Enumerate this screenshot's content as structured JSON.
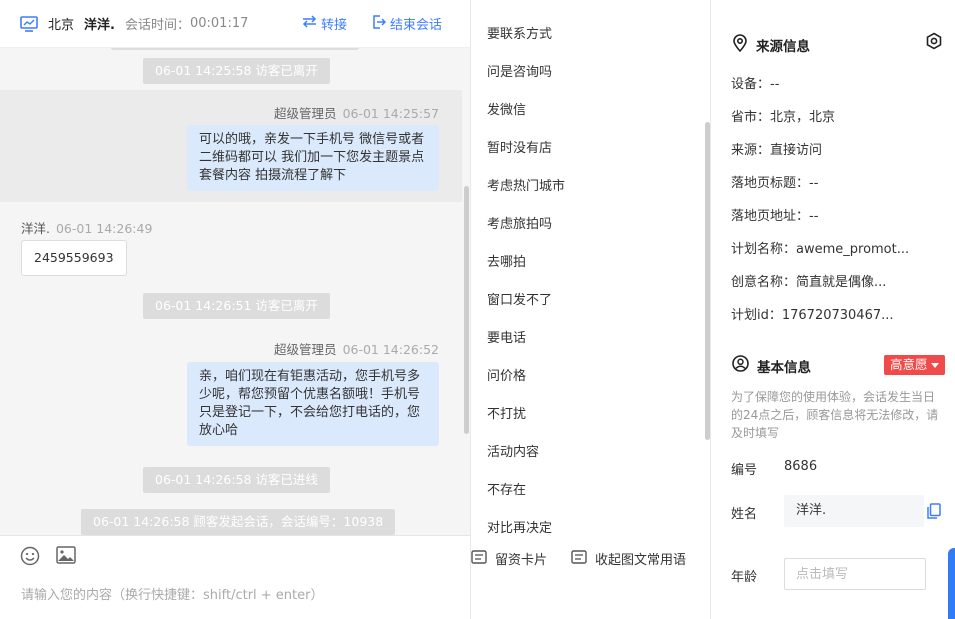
{
  "header": {
    "city": "北京",
    "visitor_name": "洋洋.",
    "duration_label": "会话时间：",
    "duration_value": "00:01:17",
    "transfer_label": "转接",
    "end_label": "结束会话",
    "accent_color": "#3d7eff"
  },
  "messages": {
    "sys1": "06-01 14:25:58 访客已离开",
    "agent1_name": "超级管理员",
    "agent1_time": "06-01 14:25:57",
    "agent1_text": "可以的哦，亲发一下手机号 微信号或者二维码都可以 我们加一下您发主题景点套餐内容 拍摄流程了解下",
    "visitor1_name": "洋洋.",
    "visitor1_time": "06-01 14:26:49",
    "visitor1_text": "2459559693",
    "sys2": "06-01 14:26:51 访客已离开",
    "agent2_name": "超级管理员",
    "agent2_time": "06-01 14:26:52",
    "agent2_text": "亲，咱们现在有钜惠活动，您手机号多少呢，帮您预留个优惠名额哦！手机号只是登记一下，不会给您打电话的，您放心哈",
    "sys3": "06-01 14:26:58 访客已进线",
    "sys4": "06-01 14:26:58 顾客发起会话，会话编号：10938"
  },
  "composer": {
    "placeholder": "请输入您的内容（换行快捷键：shift/ctrl + enter）"
  },
  "phrases": {
    "items": [
      "要联系方式",
      "问是咨询吗",
      "发微信",
      "暂时没有店",
      "考虑热门城市",
      "考虑旅拍吗",
      "去哪拍",
      "窗口发不了",
      "要电话",
      "问价格",
      "不打扰",
      "活动内容",
      "不存在",
      "对比再决定"
    ],
    "card_label": "留资卡片",
    "collapse_label": "收起图文常用语"
  },
  "source_info": {
    "title": "来源信息",
    "device": "设备：--",
    "province": "省市：北京，北京",
    "source": "来源：直接访问",
    "landing_title": "落地页标题：--",
    "landing_url": "落地页地址：--",
    "plan_name": "计划名称：aweme_promot...",
    "creative_name": "创意名称：简直就是偶像...",
    "plan_id": "计划id：176720730467..."
  },
  "basic_info": {
    "title": "基本信息",
    "intent_badge": "高意愿",
    "intent_color": "#f04a4a",
    "notice": "为了保障您的使用体验，会话发生当日的24点之后，顾客信息将无法修改，请及时填写",
    "id_label": "编号",
    "id_value": "8686",
    "name_label": "姓名",
    "name_value": "洋洋.",
    "age_label": "年龄",
    "age_placeholder": "点击填写"
  }
}
